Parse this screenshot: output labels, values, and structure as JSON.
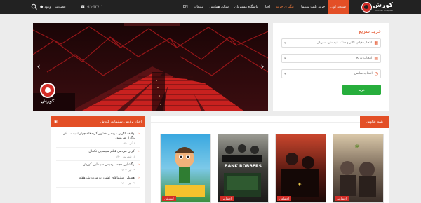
{
  "brand": {
    "name": "کورش",
    "sub": "Kourosh Cineplex"
  },
  "nav": [
    {
      "label": "صفحه اول",
      "active": true
    },
    {
      "label": "خرید بلیت سینما"
    },
    {
      "label": "زینگیری خرید",
      "accent": true
    },
    {
      "label": "اخبار"
    },
    {
      "label": "باشگاه مشتریان"
    },
    {
      "label": "سالن همایش"
    },
    {
      "label": "تبلیغات"
    },
    {
      "label": "EN"
    }
  ],
  "header": {
    "phone": "۰۲۱-۴۳۷۰۱",
    "account": "عضویت | ورود"
  },
  "quick_buy": {
    "title": "خرید سریع",
    "select_film": "انتخاب فیلم، تئاتر و جنگ، انیمیشن، سریال",
    "select_date": "انتخاب تاریخ",
    "select_time": "انتخاب سانس",
    "buy_label": "خرید"
  },
  "news": {
    "title": "اخبار پردیس سینمایی کورش",
    "items": [
      {
        "title": "توقیف اکران مردمی «شهر گربه‌ها» چهارشنبه ۱۰ آذر برگزار می‌شود",
        "date": "۵ آذر ۱۴۰۰"
      },
      {
        "title": "اکران مردمی فیلم سینمایی تکخال",
        "date": "۱۸ شهریور ۱۴۰۰"
      },
      {
        "title": "برگشایی مجدد پردیس سینمایی کورش",
        "date": "۲۹ تیر ۱۴۰۰"
      },
      {
        "title": "تعطیلی سینماهای کشور به مدت یک هفته",
        "date": "۳۱ تیر ۱۴۰۰"
      }
    ]
  },
  "movies": {
    "tab": "همه عناوین",
    "items": [
      {
        "badge": "اجتماعی",
        "title": ""
      },
      {
        "badge": "اجتماعی",
        "title": ""
      },
      {
        "badge": "اجتماعی",
        "title": "BANK ROBBERS"
      },
      {
        "badge": "انیمیشن",
        "title": ""
      }
    ]
  },
  "colors": {
    "accent": "#e34f26",
    "topbar": "#222222",
    "buy": "#27ae3c",
    "seats": "#c8211f"
  }
}
